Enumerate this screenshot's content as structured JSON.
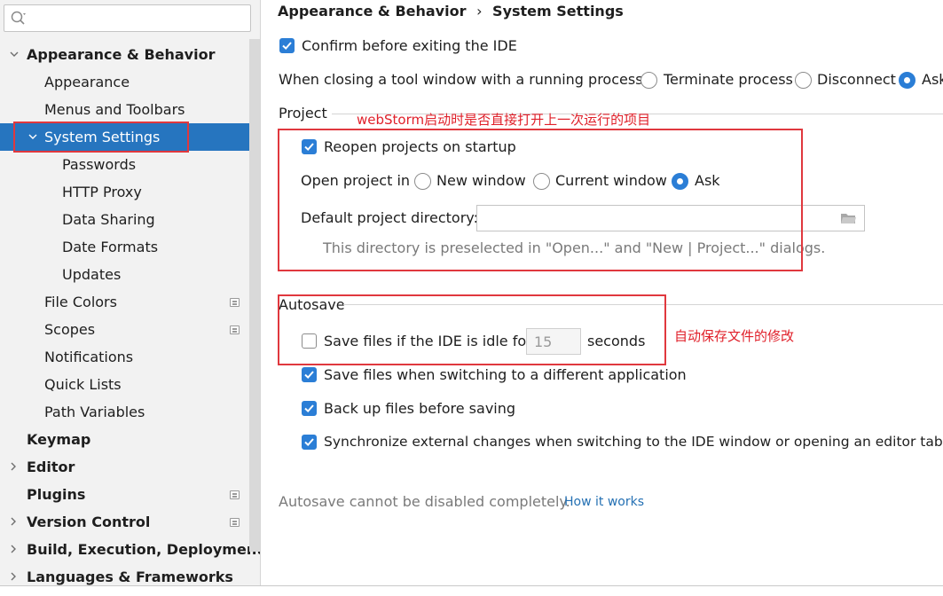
{
  "sidebar": {
    "search": {
      "placeholder": ""
    },
    "items": [
      {
        "label": "Appearance & Behavior",
        "name": "sidebar-item-appearance-behavior"
      },
      {
        "label": "Appearance",
        "name": "sidebar-item-appearance"
      },
      {
        "label": "Menus and Toolbars",
        "name": "sidebar-item-menus-toolbars"
      },
      {
        "label": "System Settings",
        "name": "sidebar-item-system-settings"
      },
      {
        "label": "Passwords",
        "name": "sidebar-item-passwords"
      },
      {
        "label": "HTTP Proxy",
        "name": "sidebar-item-http-proxy"
      },
      {
        "label": "Data Sharing",
        "name": "sidebar-item-data-sharing"
      },
      {
        "label": "Date Formats",
        "name": "sidebar-item-date-formats"
      },
      {
        "label": "Updates",
        "name": "sidebar-item-updates"
      },
      {
        "label": "File Colors",
        "name": "sidebar-item-file-colors"
      },
      {
        "label": "Scopes",
        "name": "sidebar-item-scopes"
      },
      {
        "label": "Notifications",
        "name": "sidebar-item-notifications"
      },
      {
        "label": "Quick Lists",
        "name": "sidebar-item-quick-lists"
      },
      {
        "label": "Path Variables",
        "name": "sidebar-item-path-variables"
      },
      {
        "label": "Keymap",
        "name": "sidebar-item-keymap"
      },
      {
        "label": "Editor",
        "name": "sidebar-item-editor"
      },
      {
        "label": "Plugins",
        "name": "sidebar-item-plugins"
      },
      {
        "label": "Version Control",
        "name": "sidebar-item-version-control"
      },
      {
        "label": "Build, Execution, Deployment",
        "name": "sidebar-item-build-execution-deployment"
      },
      {
        "label": "Languages & Frameworks",
        "name": "sidebar-item-languages-frameworks"
      }
    ],
    "selected": "System Settings"
  },
  "breadcrumb": {
    "parent": "Appearance & Behavior",
    "separator": "›",
    "current": "System Settings"
  },
  "general": {
    "confirm_exit": {
      "label": "Confirm before exiting the IDE",
      "checked": true
    },
    "closing_tool_window": {
      "label": "When closing a tool window with a running process:",
      "options": [
        "Terminate process",
        "Disconnect",
        "Ask"
      ],
      "selected": "Ask"
    }
  },
  "project": {
    "title": "Project",
    "reopen": {
      "label": "Reopen projects on startup",
      "checked": true
    },
    "open_project_in": {
      "label": "Open project in",
      "options": [
        "New window",
        "Current window",
        "Ask"
      ],
      "selected": "Ask"
    },
    "default_dir": {
      "label": "Default project directory:",
      "value": "",
      "hint": "This directory is preselected in \"Open...\" and \"New | Project...\" dialogs."
    }
  },
  "autosave": {
    "title": "Autosave",
    "idle": {
      "label": "Save files if the IDE is idle for",
      "checked": false,
      "value": "15",
      "unit": "seconds"
    },
    "switching": {
      "label": "Save files when switching to a different application",
      "checked": true
    },
    "backup": {
      "label": "Back up files before saving",
      "checked": true
    },
    "sync": {
      "label": "Synchronize external changes when switching to the IDE window or opening an editor tab",
      "checked": true
    },
    "note": "Autosave cannot be disabled completely.",
    "how_it_works": "How it works"
  },
  "annotations": {
    "project_note": "webStorm启动时是否直接打开上一次运行的项目",
    "autosave_note": "自动保存文件的修改"
  },
  "colors": {
    "accent": "#2b7ed6",
    "selection": "#2675bf",
    "annotation": "#e0383e"
  }
}
